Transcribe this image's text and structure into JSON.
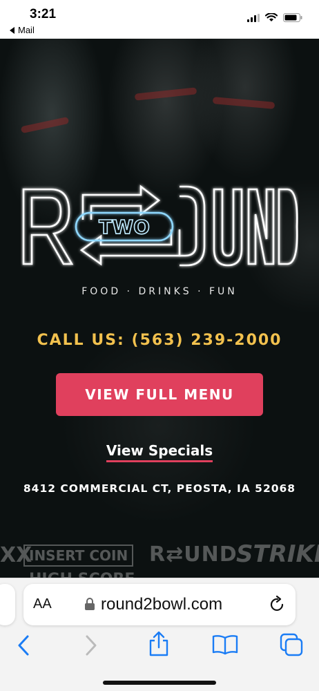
{
  "status_bar": {
    "time": "3:21",
    "back_app": "Mail",
    "icons": [
      "signal-icon",
      "wifi-icon",
      "battery-icon"
    ]
  },
  "hero": {
    "logo": {
      "left_letter": "R",
      "center_word": "TWO",
      "right_letters": "UND",
      "neon_color": "#ffffff",
      "accent_color": "#8fd8ff"
    },
    "tagline": "FOOD · DRINKS · FUN",
    "call_us": "CALL US: (563) 239-2000",
    "menu_button": "VIEW FULL MENU",
    "specials_link": "View Specials",
    "address": "8412 COMMERCIAL CT, PEOSTA, IA 52068",
    "promo_strip": {
      "xx": "XX",
      "insert_coin": "INSERT COIN",
      "round_logo": "R⇄UND",
      "strike": "STRIKE!",
      "high_score": "HIGH SCORE"
    }
  },
  "browser": {
    "text_size_label": "AA",
    "url": "round2bowl.com",
    "toolbar": [
      "back-icon",
      "forward-icon",
      "share-icon",
      "bookmarks-icon",
      "tabs-icon"
    ]
  },
  "colors": {
    "brand_red": "#e0405d",
    "call_yellow": "#f2c14e",
    "ios_blue": "#1a7cf5"
  }
}
